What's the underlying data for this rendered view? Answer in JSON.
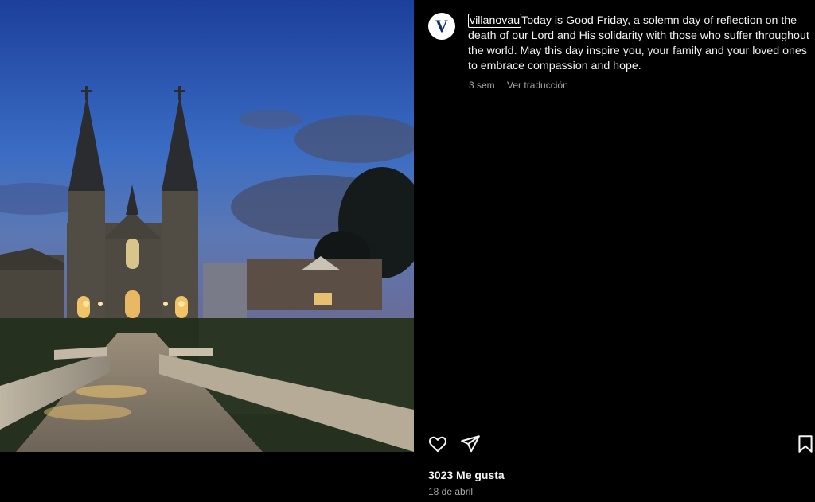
{
  "post": {
    "image_alt": "Villanova church at dusk",
    "avatar_letter": "V",
    "username": "villanovau",
    "caption": "Today is Good Friday, a solemn day of reflection on the death of our Lord and His solidarity with those who suffer throughout the world. May this day inspire you, your family and your loved ones to embrace compassion and hope.",
    "time_ago": "3 sem",
    "translate_label": "Ver traducción",
    "likes": "3023 Me gusta",
    "date": "18 de abril"
  },
  "icons": {
    "like": "heart-icon",
    "share": "paper-plane-icon",
    "save": "bookmark-icon"
  }
}
